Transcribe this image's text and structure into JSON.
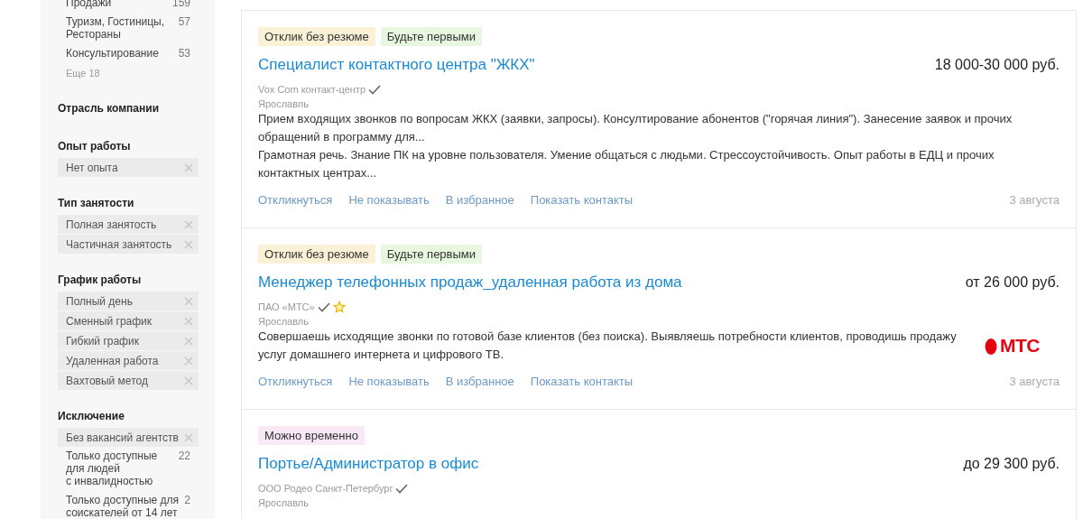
{
  "sidebar": {
    "groups": [
      {
        "items": [
          {
            "kind": "count",
            "label": "Продажи",
            "count": "159"
          },
          {
            "kind": "count",
            "label": "Туризм, Гостиницы, Рестораны",
            "count": "57"
          },
          {
            "kind": "count",
            "label": "Консультирование",
            "count": "53"
          }
        ],
        "more": "Еще 18"
      },
      {
        "title": "Отрасль компании"
      },
      {
        "title": "Опыт работы",
        "items": [
          {
            "kind": "chip",
            "label": "Нет опыта"
          }
        ]
      },
      {
        "title": "Тип занятости",
        "items": [
          {
            "kind": "chip",
            "label": "Полная занятость"
          },
          {
            "kind": "chip",
            "label": "Частичная занятость"
          }
        ]
      },
      {
        "title": "График работы",
        "items": [
          {
            "kind": "chip",
            "label": "Полный день"
          },
          {
            "kind": "chip",
            "label": "Сменный график"
          },
          {
            "kind": "chip",
            "label": "Гибкий график"
          },
          {
            "kind": "chip",
            "label": "Удаленная работа"
          },
          {
            "kind": "chip",
            "label": "Вахтовый метод"
          }
        ]
      },
      {
        "title": "Исключение",
        "items": [
          {
            "kind": "chip",
            "label": "Без вакансий агентств"
          },
          {
            "kind": "count",
            "label": "Только доступные для людей\nс инвалидностью",
            "count": "22"
          },
          {
            "kind": "count",
            "label": "Только доступные для соискателей от 14 лет",
            "count": "2"
          }
        ]
      }
    ]
  },
  "vacancies": [
    {
      "tags": [
        {
          "label": "Отклик без резюме",
          "color": "#fbf1d6"
        },
        {
          "label": "Будьте первыми",
          "color": "#e7f7e0"
        }
      ],
      "title": "Специалист контактного центра \"ЖКХ\"",
      "salary": "18 000-30 000 руб.",
      "company": "Vox Com контакт-центр",
      "verified": true,
      "premium": false,
      "city": "Ярославль",
      "description": [
        "Прием входящих звонков по вопросам ЖКХ (заявки, запросы). Консултирование абонентов (\"горячая линия\"). Занесение заявок и прочих обращений в программу для...",
        "Грамотная речь. Знание ПК на уровне пользователя. Умение общаться с людьми. Стрессоустойчивость. Опыт работы в ЕДЦ и прочих контактных центрах..."
      ],
      "actions": [
        "Откликнуться",
        "Не показывать",
        "В избранное",
        "Показать контакты"
      ],
      "date": "3 августа"
    },
    {
      "tags": [
        {
          "label": "Отклик без резюме",
          "color": "#fbf1d6"
        },
        {
          "label": "Будьте первыми",
          "color": "#e7f7e0"
        }
      ],
      "title": "Менеджер телефонных продаж_удаленная работа из дома",
      "salary": "от 26 000 руб.",
      "company": "ПАО «МТС»",
      "verified": true,
      "premium": true,
      "city": "Ярославль",
      "description": [
        "Совершаешь исходящие звонки по готовой базе клиентов (без поиска). Выявляешь потребности клиентов, проводишь продажу услуг домашнего интернета и цифрового ТВ."
      ],
      "logo": "МТС",
      "actions": [
        "Откликнуться",
        "Не показывать",
        "В избранное",
        "Показать контакты"
      ],
      "date": "3 августа"
    },
    {
      "tags": [
        {
          "label": "Можно временно",
          "color": "#f9e9f6"
        }
      ],
      "title": "Портье/Администратор в офис",
      "salary": "до 29 300 руб.",
      "company": "ООО Родео Санкт-Петербург",
      "verified": true,
      "premium": false,
      "city": "Ярославль"
    }
  ]
}
